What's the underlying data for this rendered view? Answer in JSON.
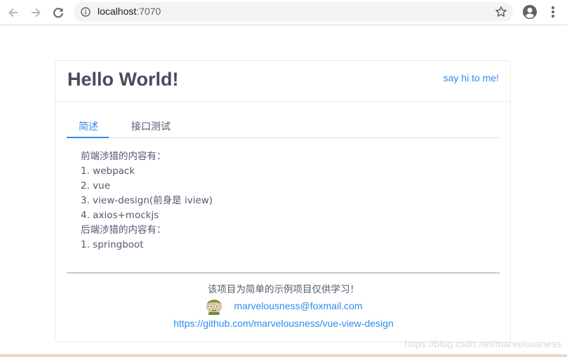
{
  "browser": {
    "url_host": "localhost",
    "url_port": ":7070",
    "icons": [
      "back-arrow-icon",
      "forward-arrow-icon",
      "reload-icon",
      "info-icon",
      "star-icon",
      "profile-icon",
      "menu-dots-icon"
    ]
  },
  "card": {
    "title": "Hello World!",
    "extra_link": "say hi to me!"
  },
  "tabs": [
    {
      "label": "简述",
      "active": true
    },
    {
      "label": "接口测试",
      "active": false
    }
  ],
  "content": {
    "lines": [
      "前端涉猎的内容有：",
      "1. webpack",
      "2. vue",
      "3. view-design(前身是 iview)",
      "4. axios+mockjs",
      "后端涉猎的内容有：",
      "1. springboot"
    ]
  },
  "footer": {
    "note": "该项目为简单的示例项目仅供学习！",
    "email": "marvelousness@foxmail.com",
    "github": "https://github.com/marvelousness/vue-view-design"
  },
  "watermark": "https://blog.csdn.net/marvelousness",
  "colors": {
    "accent": "#2d8cf0",
    "text": "#515a6e",
    "title": "#464c5b"
  }
}
